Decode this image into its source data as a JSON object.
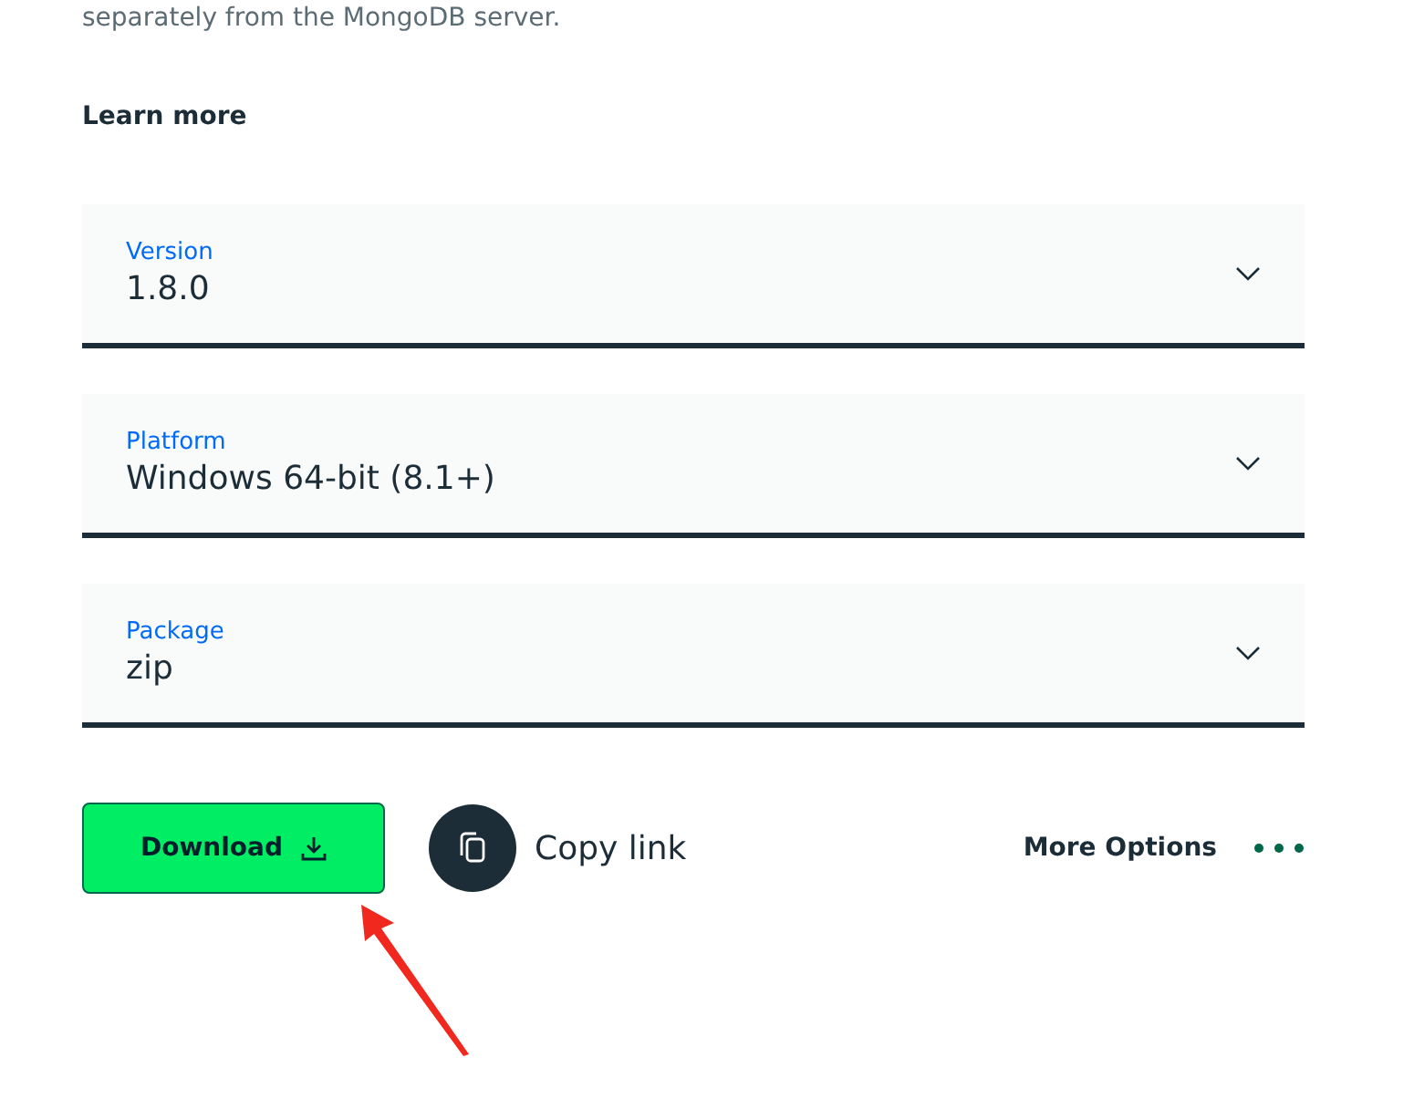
{
  "intro_text": "separately from the MongoDB server.",
  "learn_more": "Learn more",
  "selects": [
    {
      "label": "Version",
      "value": "1.8.0"
    },
    {
      "label": "Platform",
      "value": "Windows 64-bit (8.1+)"
    },
    {
      "label": "Package",
      "value": "zip"
    }
  ],
  "download_button": "Download",
  "copy_link": "Copy link",
  "more_options": "More Options"
}
